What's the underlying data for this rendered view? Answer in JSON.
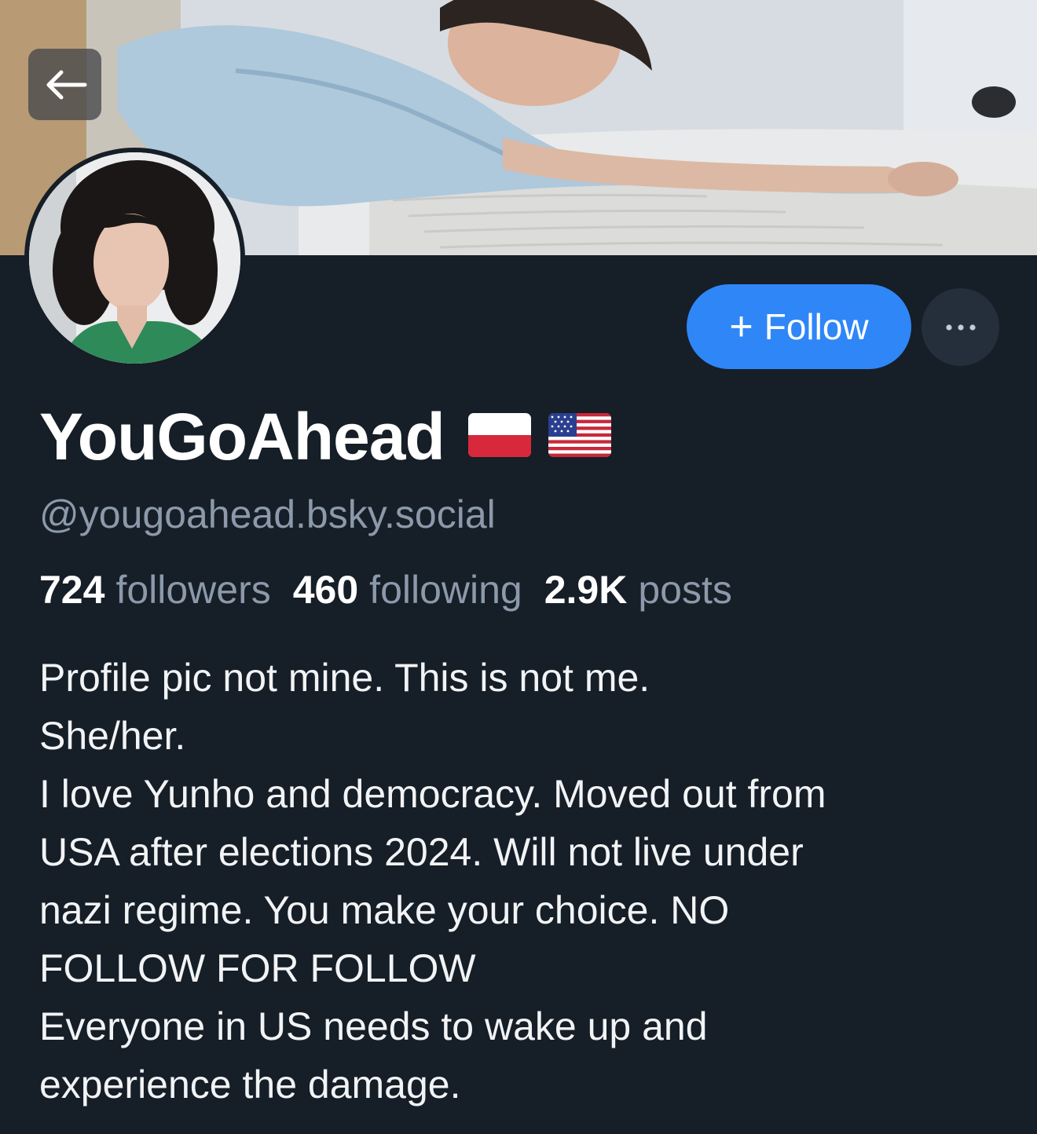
{
  "header": {
    "back_icon": "arrow-left-icon"
  },
  "profile": {
    "display_name": "YouGoAhead",
    "flags": [
      "poland-flag",
      "usa-flag"
    ],
    "handle": "@yougoahead.bsky.social",
    "follow_label": "Follow",
    "more_icon": "ellipsis-icon"
  },
  "stats": {
    "followers_count": "724",
    "followers_label": "followers",
    "following_count": "460",
    "following_label": "following",
    "posts_count": "2.9K",
    "posts_label": "posts"
  },
  "bio": {
    "line1": "Profile pic not mine. This is not me.",
    "line2": "She/her.",
    "line3": "I love Yunho and democracy. Moved out from",
    "line4": "USA after elections 2024. Will not live under",
    "line5": "nazi regime. You make your choice. NO",
    "line6": "FOLLOW FOR FOLLOW",
    "line7": "Everyone in US needs to wake up and",
    "line8": "experience the damage."
  },
  "colors": {
    "background": "#161e27",
    "accent": "#2f86f6",
    "muted_text": "#8b99aa"
  }
}
